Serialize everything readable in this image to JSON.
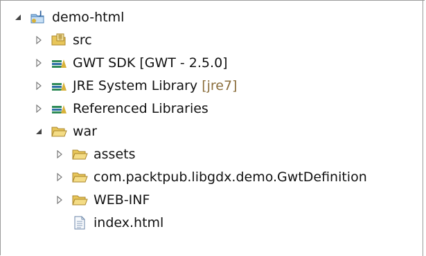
{
  "tree": {
    "project": {
      "label": "demo-html"
    },
    "src": {
      "label": "src"
    },
    "gwt_sdk": {
      "label": "GWT SDK [GWT - 2.5.0]"
    },
    "jre": {
      "label": "JRE System Library",
      "decoration": "[jre7]"
    },
    "ref_libs": {
      "label": "Referenced Libraries"
    },
    "war": {
      "label": "war"
    },
    "assets": {
      "label": "assets"
    },
    "gwtdef": {
      "label": "com.packtpub.libgdx.demo.GwtDefinition"
    },
    "webinf": {
      "label": "WEB-INF"
    },
    "index": {
      "label": "index.html"
    }
  },
  "icons": {
    "project": "java-project-icon",
    "src": "source-folder-icon",
    "library": "library-icon",
    "folder": "folder-icon",
    "file": "html-file-icon",
    "expanded": "expanded-arrow-icon",
    "collapsed": "collapsed-arrow-icon"
  },
  "colors": {
    "decoration": "#8a6d3b",
    "folder": "#e8c65a",
    "library_green": "#2e8b57",
    "library_yellow": "#d8b23a",
    "arrow_expanded": "#444444",
    "arrow_collapsed": "#7a7a7a"
  }
}
